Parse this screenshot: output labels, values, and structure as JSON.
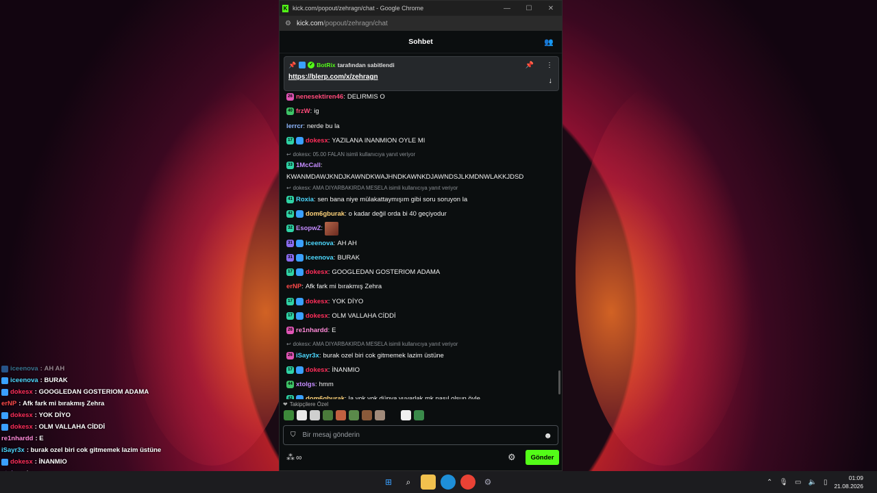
{
  "window": {
    "title": "kick.com/popout/zehragn/chat - Google Chrome",
    "url_domain": "kick.com",
    "url_path": "/popout/zehragn/chat",
    "min": "—",
    "max": "☐",
    "close": "✕"
  },
  "chat": {
    "title": "Sohbet",
    "pinned": {
      "user": "BotRix",
      "by_text": "tarafından sabitlendi",
      "link": "https://blerp.com/x/zehragn"
    },
    "messages": [
      {
        "badge": "pink",
        "badgeText": "26",
        "tier": false,
        "user": "nenesektiren46",
        "color": "#ff4a7a",
        "text": "DELIRMIS O"
      },
      {
        "badge": "green",
        "badgeText": "40",
        "tier": false,
        "user": "frzW",
        "color": "#ff4a7a",
        "text": "ig"
      },
      {
        "badge": "",
        "badgeText": "",
        "tier": false,
        "user": "lerrcr",
        "color": "#8fb8ff",
        "text": "nerde bu la"
      },
      {
        "badge": "sub",
        "badgeText": "17",
        "tier": true,
        "user": "dokesx",
        "color": "#ff2e5a",
        "text": "YAZILANA INANMION OYLE MI"
      }
    ],
    "reply1": "dokesx: 05.00 FALAN isimli kullanıcıya yanıt veriyor",
    "mccall": {
      "user": "1McCall",
      "badgeText": "33",
      "text": "KWANMDAWJKNDJKAWNDKWAJHNDKAWNKDJAWNDSJLKMDNWLAKKJDSD"
    },
    "reply2": "dokesx: AMA DIYARBAKIRDA MESELA isimli kullanıcıya yanıt veriyor",
    "messages2": [
      {
        "badge": "sub",
        "badgeText": "41",
        "tier": false,
        "user": "Roxia",
        "color": "#4dd9ff",
        "text": "sen bana niye mülakattaymışım gibi soru soruyon la"
      },
      {
        "badge": "sub",
        "badgeText": "42",
        "tier": true,
        "user": "dom6gburak",
        "color": "#ffd37a",
        "text": "o kadar değil orda bi 40 geçiyodur"
      },
      {
        "badge": "sub",
        "badgeText": "32",
        "tier": false,
        "user": "EsopwZ",
        "color": "#c58cff",
        "text": ""
      },
      {
        "badge": "violet",
        "badgeText": "31",
        "tier": true,
        "user": "iceenova",
        "color": "#4dd9ff",
        "text": "AH AH"
      },
      {
        "badge": "violet",
        "badgeText": "31",
        "tier": true,
        "user": "iceenova",
        "color": "#4dd9ff",
        "text": "BURAK"
      },
      {
        "badge": "sub",
        "badgeText": "17",
        "tier": true,
        "user": "dokesx",
        "color": "#ff2e5a",
        "text": "GOOGLEDAN GOSTERIOM ADAMA"
      },
      {
        "badge": "",
        "badgeText": "",
        "tier": false,
        "user": "erNP",
        "color": "#ff4a4a",
        "text": "Afk fark mi bırakmış Zehra"
      },
      {
        "badge": "sub",
        "badgeText": "17",
        "tier": true,
        "user": "dokesx",
        "color": "#ff2e5a",
        "text": "YOK DİYO"
      },
      {
        "badge": "sub",
        "badgeText": "17",
        "tier": true,
        "user": "dokesx",
        "color": "#ff2e5a",
        "text": "OLM VALLAHA CİDDİ"
      },
      {
        "badge": "pink",
        "badgeText": "26",
        "tier": false,
        "user": "re1nhardd",
        "color": "#ff8ad8",
        "text": "E"
      }
    ],
    "reply3": "dokesx: AMA DIYARBAKIRDA MESELA isimli kullanıcıya yanıt veriyor",
    "messages3": [
      {
        "badge": "pink",
        "badgeText": "26",
        "tier": false,
        "user": "iSayr3x",
        "color": "#4dd9ff",
        "text": "burak ozel biri cok gitmemek lazim üstüne"
      },
      {
        "badge": "sub",
        "badgeText": "17",
        "tier": true,
        "user": "dokesx",
        "color": "#ff2e5a",
        "text": "İNANMIO"
      },
      {
        "badge": "green",
        "badgeText": "44",
        "tier": false,
        "user": "xtolgs",
        "color": "#c58cff",
        "text": "hmm"
      },
      {
        "badge": "sub",
        "badgeText": "42",
        "tier": true,
        "user": "dom6gburak",
        "color": "#ffd37a",
        "text": "la yok yok dünya yuvarlak mk nasıl olsun öyle"
      }
    ],
    "followers_label": "Takipçilere Özel",
    "input_placeholder": "Bir mesaj gönderin",
    "send_label": "Gönder"
  },
  "overlay": [
    {
      "user": "iceenova",
      "color": "#4dd9ff",
      "text": "AH AH",
      "badge": true,
      "faded": true
    },
    {
      "user": "iceenova",
      "color": "#4dd9ff",
      "text": "BURAK",
      "badge": true,
      "faded": false
    },
    {
      "user": "dokesx",
      "color": "#ff2e5a",
      "text": "GOOGLEDAN GOSTERIOM ADAMA",
      "badge": true,
      "faded": false
    },
    {
      "user": "erNP",
      "color": "#ff4a4a",
      "text": "Afk fark mi bırakmış Zehra",
      "badge": false,
      "faded": false
    },
    {
      "user": "dokesx",
      "color": "#ff2e5a",
      "text": "YOK DİYO",
      "badge": true,
      "faded": false
    },
    {
      "user": "dokesx",
      "color": "#ff2e5a",
      "text": "OLM VALLAHA CİDDİ",
      "badge": true,
      "faded": false
    },
    {
      "user": "re1nhardd",
      "color": "#ff8ad8",
      "text": "E",
      "badge": false,
      "faded": false
    },
    {
      "user": "iSayr3x",
      "color": "#4dd9ff",
      "text": "burak ozel biri cok gitmemek lazim üstüne",
      "badge": false,
      "faded": false
    },
    {
      "user": "dokesx",
      "color": "#ff2e5a",
      "text": "İNANMIO",
      "badge": true,
      "faded": false
    },
    {
      "user": "xtolgs",
      "color": "#c58cff",
      "text": "hmm",
      "badge": false,
      "faded": false
    },
    {
      "user": "dom6gburak",
      "color": "#ffd37a",
      "text": "la yok yok dünya yuvarlak mk nasıl olsun öyle",
      "badge": false,
      "faded": true,
      "veryFaded": true
    }
  ],
  "taskbar": {
    "time": "01:09",
    "date": "21.08.2026"
  }
}
